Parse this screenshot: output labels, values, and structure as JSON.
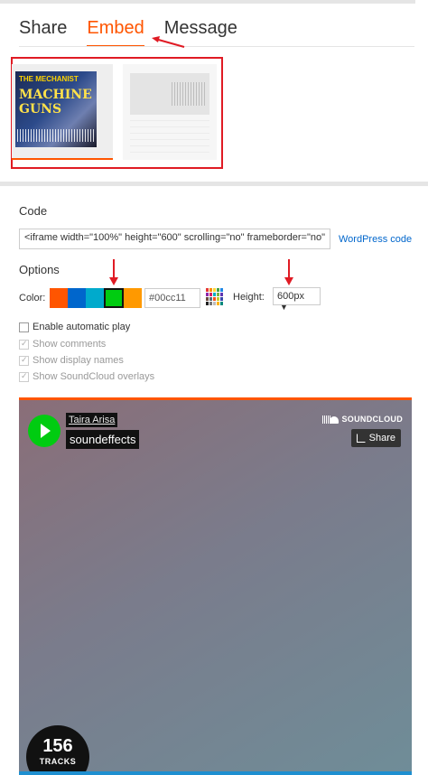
{
  "tabs": [
    {
      "label": "Share",
      "active": false
    },
    {
      "label": "Embed",
      "active": true
    },
    {
      "label": "Message",
      "active": false
    }
  ],
  "code": {
    "label": "Code",
    "value": "<iframe width=\"100%\" height=\"600\" scrolling=\"no\" frameborder=\"no\"",
    "wordpress_link": "WordPress code"
  },
  "options": {
    "label": "Options",
    "color_label": "Color:",
    "swatches": [
      "#ff5500",
      "#0066cc",
      "#00aacc",
      "#00cc11",
      "#ff9900"
    ],
    "selected_color_hex": "#00cc11",
    "height_label": "Height:",
    "height_value": "600px"
  },
  "checkboxes": [
    {
      "label": "Enable automatic play",
      "checked": false,
      "disabled": false
    },
    {
      "label": "Show comments",
      "checked": true,
      "disabled": true
    },
    {
      "label": "Show display names",
      "checked": true,
      "disabled": true
    },
    {
      "label": "Show SoundCloud overlays",
      "checked": true,
      "disabled": true
    }
  ],
  "player": {
    "artist": "Taira Arisa",
    "title": "soundeffects",
    "brand": "SOUNDCLOUD",
    "share_label": "Share",
    "tracks_count": "156",
    "tracks_label": "TRACKS"
  },
  "thumbnail": {
    "line1": "THE MECHANIST",
    "line2": "MACHINE GUNS"
  },
  "colors": {
    "accent": "#ff5500",
    "annotation_red": "#e01b24",
    "play_button": "#00cc11"
  }
}
